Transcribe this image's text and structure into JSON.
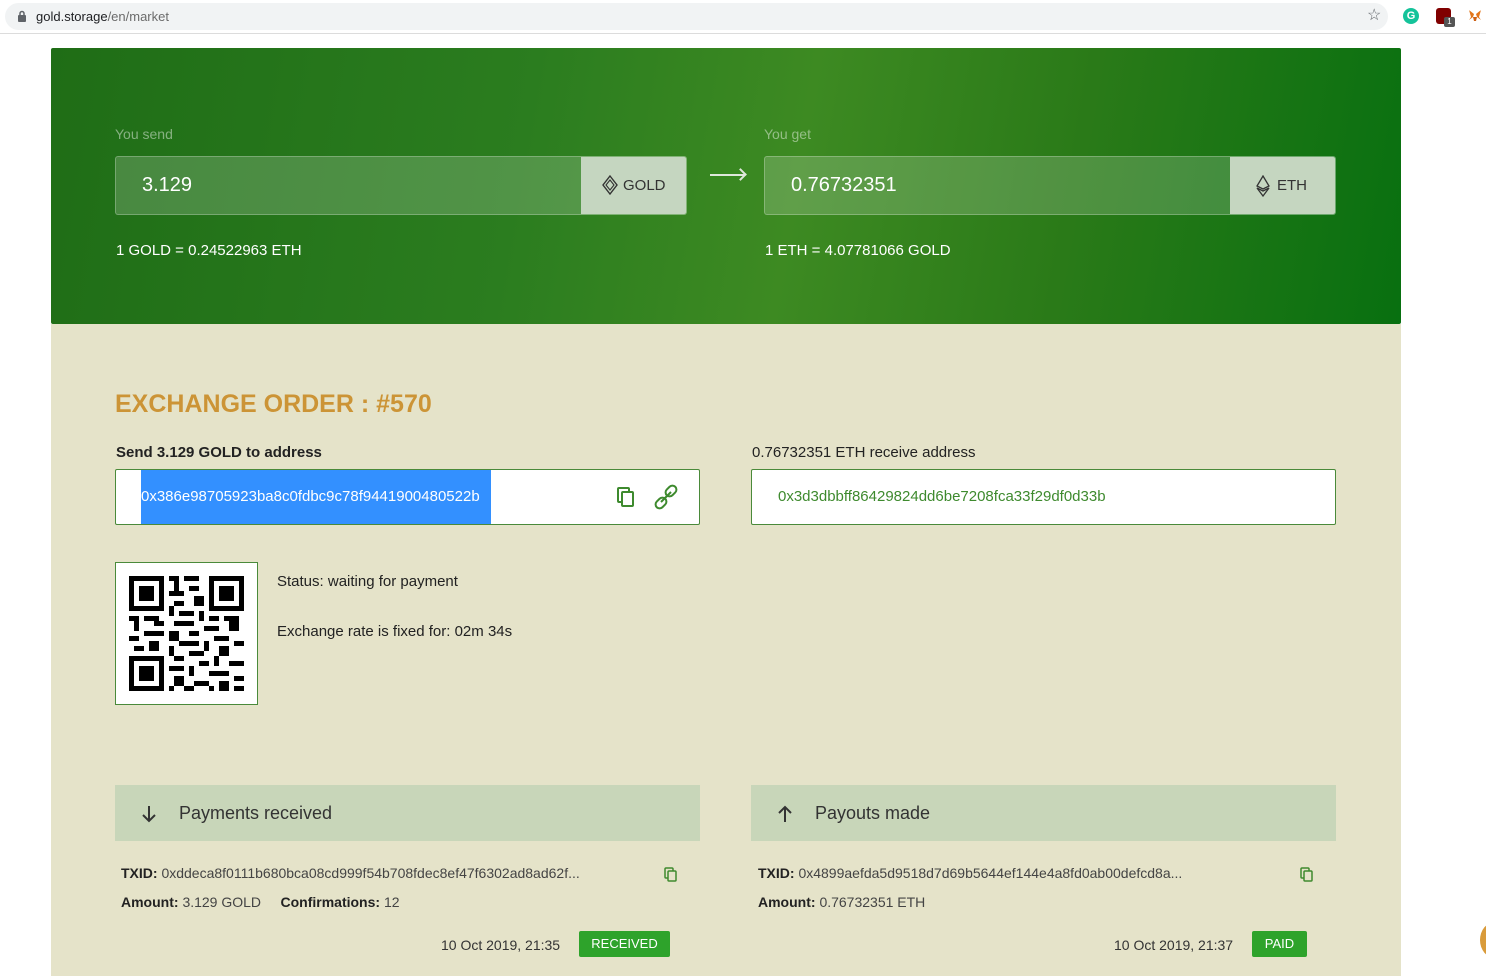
{
  "browser": {
    "url_host": "gold.storage",
    "url_path": "/en/market"
  },
  "exchange": {
    "send_label": "You send",
    "send_amount": "3.129",
    "send_currency": "GOLD",
    "get_label": "You get",
    "get_amount": "0.76732351",
    "get_currency": "ETH",
    "rate_send": "1 GOLD = 0.24522963 ETH",
    "rate_get": "1 ETH = 4.07781066 GOLD"
  },
  "order": {
    "title": "EXCHANGE ORDER : #570",
    "send_address_label": "Send 3.129 GOLD to address",
    "send_address": "0x386e98705923ba8c0fdbc9c78f9441900480522b",
    "receive_address_label": "0.76732351 ETH receive address",
    "receive_address": "0x3d3dbbff86429824dd6be7208fca33f29df0d33b",
    "status": "Status: waiting for payment",
    "rate_fixed": "Exchange rate is fixed for: 02m 34s"
  },
  "payments_received": {
    "title": "Payments received",
    "txid_label": "TXID:",
    "txid": "0xddeca8f0111b680bca08cd999f54b708fdec8ef47f6302ad8ad62f...",
    "amount_label": "Amount:",
    "amount": "3.129 GOLD",
    "confirmations_label": "Confirmations:",
    "confirmations": "12",
    "date": "10 Oct 2019, 21:35",
    "badge": "RECEIVED"
  },
  "payouts_made": {
    "title": "Payouts made",
    "txid_label": "TXID:",
    "txid": "0x4899aefda5d9518d7d69b5644ef144e4a8fd0ab00defcd8a...",
    "amount_label": "Amount:",
    "amount": "0.76732351 ETH",
    "date": "10 Oct 2019, 21:37",
    "badge": "PAID"
  },
  "colors": {
    "hero_green": "#2b7d1f",
    "body_bg": "#e5e3c9",
    "title_gold": "#cc9436",
    "badge_green": "#2ea32b",
    "selection_blue": "#3390ff"
  },
  "icons": [
    "lock-icon",
    "star-icon",
    "gold-diamond-icon",
    "eth-icon",
    "arrow-right-icon",
    "copy-icon",
    "link-icon",
    "qr-code",
    "arrow-down-icon",
    "arrow-up-icon"
  ]
}
